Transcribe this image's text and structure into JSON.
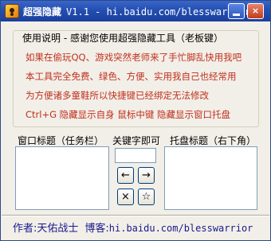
{
  "window": {
    "app_name": "超强隐藏",
    "title_suffix": "V1.1 - hi.baidu.com/blesswarrior",
    "minimize_label": "",
    "close_label": "×"
  },
  "info": {
    "heading": "使用说明 - 感谢您使用超强隐藏工具（老板键）",
    "lines": [
      "如果在偷玩QQ、游戏突然老师来了手忙脚乱快用我吧",
      "本工具完全免费、绿色、方便、实用我自己也经常用",
      "为方便诸多童鞋所以快捷键已经绑定无法修改",
      "Ctrl+G 隐藏显示自身  鼠标中键 隐藏显示窗口托盘"
    ]
  },
  "labels": {
    "window_title": "窗口标题（任务栏）",
    "keyword": "关键字即可",
    "tray_title": "托盘标题（右下角）"
  },
  "inputs": {
    "keyword_value": ""
  },
  "buttons": {
    "left": "←",
    "right": "→",
    "delete": "×",
    "star": "☆"
  },
  "footer": {
    "author": "作者:天佑战士",
    "blog_label": "博客:",
    "blog_url": "hi.baidu.com/blesswarrior"
  }
}
